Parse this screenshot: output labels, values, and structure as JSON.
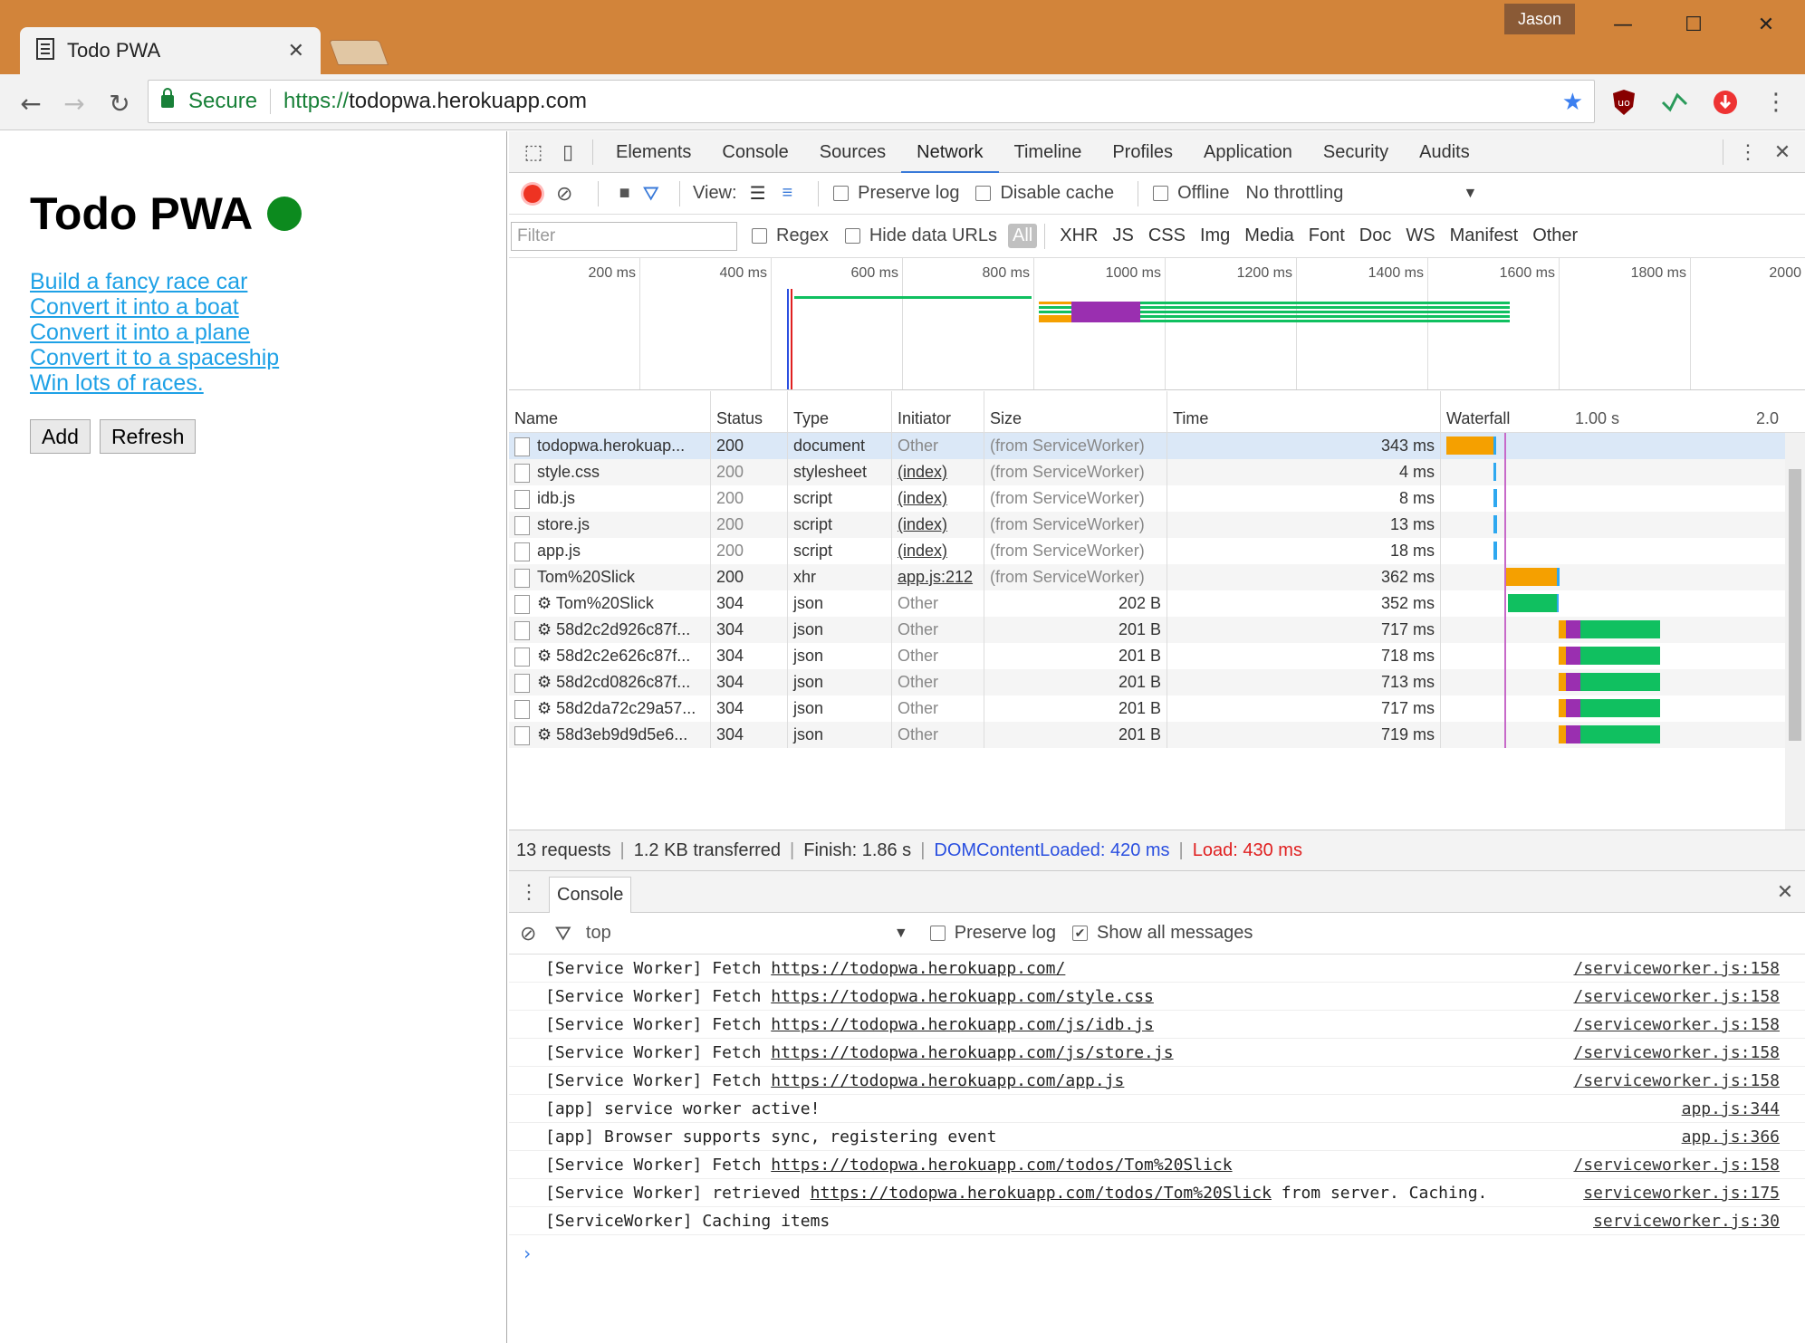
{
  "browser": {
    "tab_title": "Todo PWA",
    "tab_close": "✕",
    "user": "Jason",
    "secure_label": "Secure",
    "url_proto": "https://",
    "url_host": "todopwa.herokuapp.com"
  },
  "page": {
    "heading": "Todo PWA",
    "todos": [
      "Build a fancy race car",
      "Convert it into a boat",
      "Convert it into a plane",
      "Convert it to a spaceship",
      "Win lots of races."
    ],
    "add_label": "Add",
    "refresh_label": "Refresh"
  },
  "devtools": {
    "tabs": [
      "Elements",
      "Console",
      "Sources",
      "Network",
      "Timeline",
      "Profiles",
      "Application",
      "Security",
      "Audits"
    ],
    "active_tab": "Network",
    "toolbar": {
      "view_label": "View:",
      "preserve_log": "Preserve log",
      "disable_cache": "Disable cache",
      "offline": "Offline",
      "throttling": "No throttling"
    },
    "filter": {
      "placeholder": "Filter",
      "regex": "Regex",
      "hide_data_urls": "Hide data URLs",
      "types": [
        "All",
        "XHR",
        "JS",
        "CSS",
        "Img",
        "Media",
        "Font",
        "Doc",
        "WS",
        "Manifest",
        "Other"
      ]
    },
    "overview_ticks": [
      "200 ms",
      "400 ms",
      "600 ms",
      "800 ms",
      "1000 ms",
      "1200 ms",
      "1400 ms",
      "1600 ms",
      "1800 ms",
      "2000"
    ],
    "columns": [
      "Name",
      "Status",
      "Type",
      "Initiator",
      "Size",
      "Time",
      "Waterfall"
    ],
    "waterfall_ticks": [
      "1.00 s",
      "2.0"
    ],
    "requests": [
      {
        "name": "todopwa.herokuap...",
        "status": "200",
        "type": "document",
        "initiator": "Other",
        "size": "(from ServiceWorker)",
        "time": "343 ms"
      },
      {
        "name": "style.css",
        "status": "200",
        "type": "stylesheet",
        "initiator": "(index)",
        "size": "(from ServiceWorker)",
        "time": "4 ms"
      },
      {
        "name": "idb.js",
        "status": "200",
        "type": "script",
        "initiator": "(index)",
        "size": "(from ServiceWorker)",
        "time": "8 ms"
      },
      {
        "name": "store.js",
        "status": "200",
        "type": "script",
        "initiator": "(index)",
        "size": "(from ServiceWorker)",
        "time": "13 ms"
      },
      {
        "name": "app.js",
        "status": "200",
        "type": "script",
        "initiator": "(index)",
        "size": "(from ServiceWorker)",
        "time": "18 ms"
      },
      {
        "name": "Tom%20Slick",
        "status": "200",
        "type": "xhr",
        "initiator": "app.js:212",
        "size": "(from ServiceWorker)",
        "time": "362 ms"
      },
      {
        "name": "⚙ Tom%20Slick",
        "status": "304",
        "type": "json",
        "initiator": "Other",
        "size": "202 B",
        "time": "352 ms"
      },
      {
        "name": "⚙ 58d2c2d926c87f...",
        "status": "304",
        "type": "json",
        "initiator": "Other",
        "size": "201 B",
        "time": "717 ms"
      },
      {
        "name": "⚙ 58d2c2e626c87f...",
        "status": "304",
        "type": "json",
        "initiator": "Other",
        "size": "201 B",
        "time": "718 ms"
      },
      {
        "name": "⚙ 58d2cd0826c87f...",
        "status": "304",
        "type": "json",
        "initiator": "Other",
        "size": "201 B",
        "time": "713 ms"
      },
      {
        "name": "⚙ 58d2da72c29a57...",
        "status": "304",
        "type": "json",
        "initiator": "Other",
        "size": "201 B",
        "time": "717 ms"
      },
      {
        "name": "⚙ 58d3eb9d9d5e6...",
        "status": "304",
        "type": "json",
        "initiator": "Other",
        "size": "201 B",
        "time": "719 ms"
      }
    ],
    "summary": {
      "requests": "13 requests",
      "transferred": "1.2 KB transferred",
      "finish": "Finish: 1.86 s",
      "dcl": "DOMContentLoaded: 420 ms",
      "load": "Load: 430 ms"
    },
    "console": {
      "tab_label": "Console",
      "context": "top",
      "preserve_log": "Preserve log",
      "show_all": "Show all messages",
      "messages": [
        {
          "prefix": "[Service Worker] Fetch ",
          "link": "https://todopwa.herokuapp.com/",
          "suffix": "",
          "source": "/serviceworker.js:158"
        },
        {
          "prefix": "[Service Worker] Fetch ",
          "link": "https://todopwa.herokuapp.com/style.css",
          "suffix": "",
          "source": "/serviceworker.js:158"
        },
        {
          "prefix": "[Service Worker] Fetch ",
          "link": "https://todopwa.herokuapp.com/js/idb.js",
          "suffix": "",
          "source": "/serviceworker.js:158"
        },
        {
          "prefix": "[Service Worker] Fetch ",
          "link": "https://todopwa.herokuapp.com/js/store.js",
          "suffix": "",
          "source": "/serviceworker.js:158"
        },
        {
          "prefix": "[Service Worker] Fetch ",
          "link": "https://todopwa.herokuapp.com/app.js",
          "suffix": "",
          "source": "/serviceworker.js:158"
        },
        {
          "prefix": "[app] service worker active!",
          "link": "",
          "suffix": "",
          "source": "app.js:344"
        },
        {
          "prefix": "[app] Browser supports sync, registering event",
          "link": "",
          "suffix": "",
          "source": "app.js:366"
        },
        {
          "prefix": "[Service Worker] Fetch ",
          "link": "https://todopwa.herokuapp.com/todos/Tom%20Slick",
          "suffix": "",
          "source": "/serviceworker.js:158"
        },
        {
          "prefix": "[Service Worker] retrieved ",
          "link": "https://todopwa.herokuapp.com/todos/Tom%20Slick",
          "suffix": " from server. Caching.",
          "source": "serviceworker.js:175"
        },
        {
          "prefix": "[ServiceWorker] Caching items",
          "link": "",
          "suffix": "",
          "source": "serviceworker.js:30"
        }
      ]
    }
  },
  "colors": {
    "titlebar": "#d2843a",
    "link": "#1ea1e6",
    "online_dot": "#0c8a1e",
    "dcl": "#2a4fe0",
    "load": "#e02020"
  }
}
